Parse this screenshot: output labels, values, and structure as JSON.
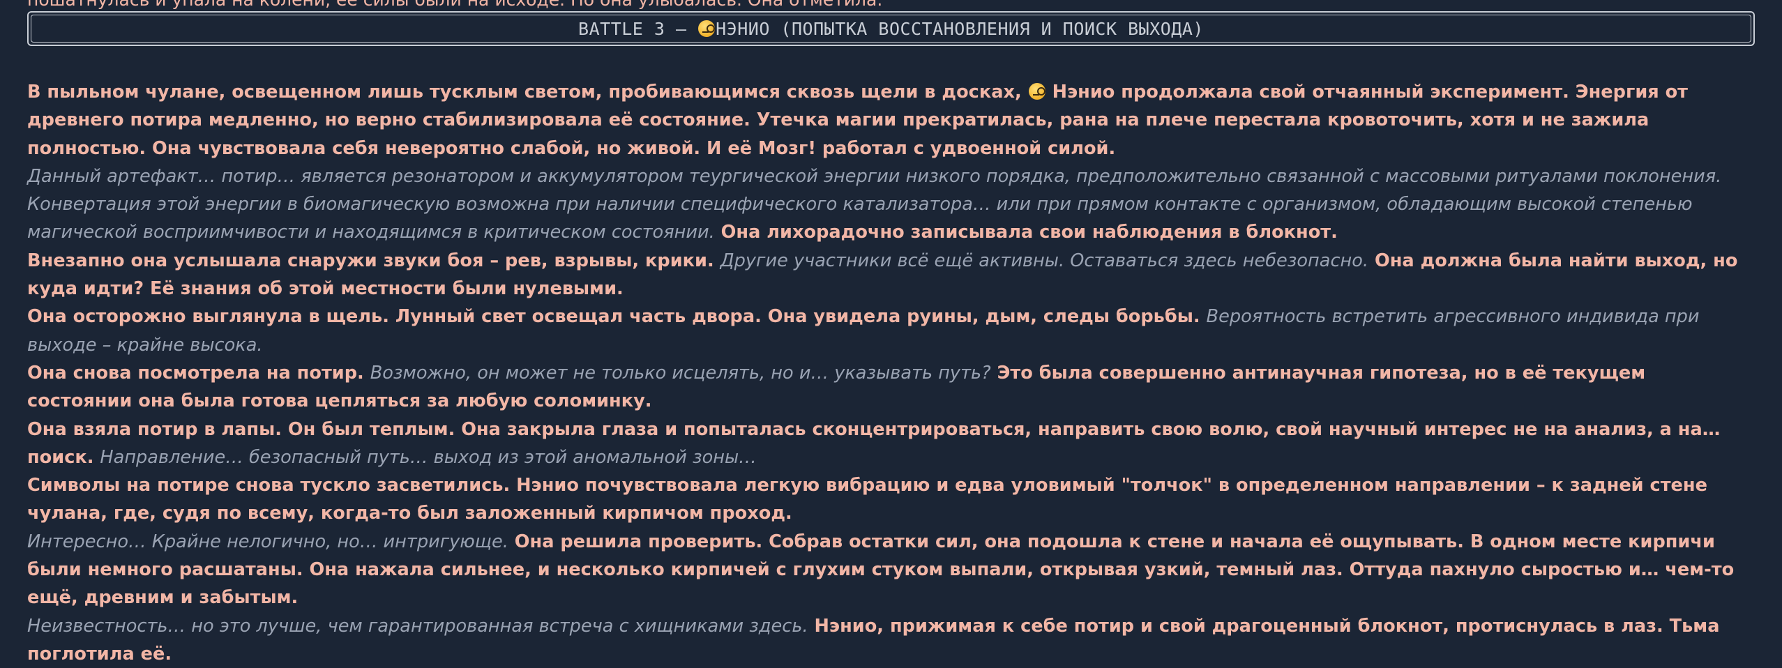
{
  "top_line": "пошатнулась и упала на колени, ее силы были на исходе. Но она улыбалась. Она отметила.",
  "title": {
    "prefix": "BATTLE 3 – ",
    "emoji": "face-with-monocle",
    "suffix": "НЭНИО (ПОПЫТКА ВОССТАНОВЛЕНИЯ И ПОИСК ВЫХОДА)"
  },
  "paragraphs": [
    {
      "p1_a": "В пыльном чулане, освещенном лишь тусклым светом, пробивающимся сквозь щели в досках,",
      "p1_name": "Нэнио",
      "p1_b": "продолжала свой отчаянный эксперимент. Энергия от древнего потира медленно, но верно стабилизировала её состояние. Утечка магии прекратилась, рана на плече перестала кровоточить, хотя и не зажила полностью. Она чувствовала себя невероятно слабой, но живой. И её",
      "p1_brain": "Мозг!",
      "p1_c": "работал с удвоенной силой."
    },
    {
      "thought": "Данный артефакт… потир… является резонатором и аккумулятором теургической энергии низкого порядка, предположительно связанной с массовыми ритуалами поклонения. Конвертация этой энергии в биомагическую возможна при наличии специфического катализатора… или при прямом контакте с организмом, обладающим высокой степенью магической восприимчивости и находящимся в критическом состоянии.",
      "text": "Она лихорадочно записывала свои наблюдения в блокнот."
    },
    {
      "text_a": "Внезапно она услышала снаружи звуки боя – рев, взрывы, крики.",
      "thought": "Другие участники всё ещё активны. Оставаться здесь небезопасно.",
      "text_b": "Она должна была найти выход, но куда идти? Её знания об этой местности были нулевыми."
    },
    {
      "text": "Она осторожно выглянула в щель. Лунный свет освещал часть двора. Она увидела руины, дым, следы борьбы.",
      "thought": "Вероятность встретить агрессивного индивида при выходе – крайне высока."
    },
    {
      "text_a": "Она снова посмотрела на потир.",
      "thought": "Возможно, он может не только исцелять, но и… указывать путь?",
      "text_b": "Это была совершенно антинаучная гипотеза, но в её текущем состоянии она была готова цепляться за любую соломинку."
    },
    {
      "text": "Она взяла потир в лапы. Он был теплым. Она закрыла глаза и попыталась сконцентрироваться, направить свою волю, свой научный интерес не на анализ, а на… поиск.",
      "thought": "Направление… безопасный путь… выход из этой аномальной зоны…"
    },
    {
      "text": "Символы на потире снова тускло засветились. Нэнио почувствовала легкую вибрацию и едва уловимый \"толчок\" в определенном направлении – к задней стене чулана, где, судя по всему, когда-то был заложенный кирпичом проход."
    },
    {
      "thought": "Интересно… Крайне нелогично, но… интригующе.",
      "text": "Она решила проверить. Собрав остатки сил, она подошла к стене и начала её ощупывать. В одном месте кирпичи были немного расшатаны. Она нажала сильнее, и несколько кирпичей с глухим стуком выпали, открывая узкий, темный лаз. Оттуда пахнуло сыростью и… чем-то ещё, древним и забытым."
    },
    {
      "thought": "Неизвестность… но это лучше, чем гарантированная встреча с хищниками здесь.",
      "text": "Нэнио, прижимая к себе потир и свой драгоценный блокнот, протиснулась в лаз. Тьма поглотила её."
    }
  ],
  "colors": {
    "background": "#1b2535",
    "narration": "#f2b6a6",
    "thought": "#9aa3b3",
    "title": "#c9ced6"
  }
}
